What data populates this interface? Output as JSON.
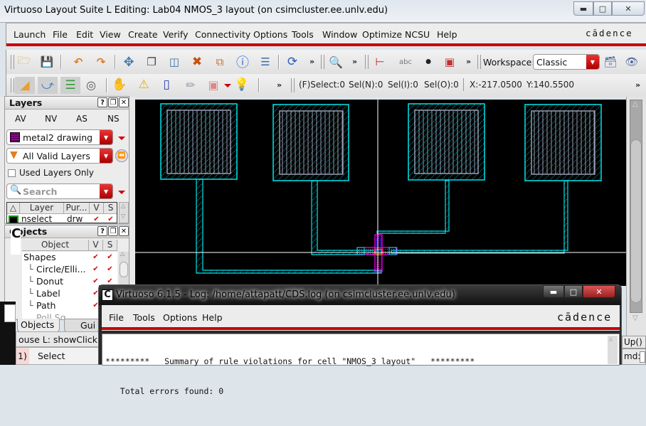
{
  "window": {
    "title": "Virtuoso Layout Suite L Editing: Lab04 NMOS_3 layout (on csimcluster.ee.unlv.edu)",
    "controls": {
      "minimize": "minimize-icon",
      "maximize": "maximize-icon",
      "close": "close-icon"
    }
  },
  "menubar": {
    "items": [
      "Launch",
      "File",
      "Edit",
      "View",
      "Create",
      "Verify",
      "Connectivity",
      "Options",
      "Tools",
      "Window",
      "Optimize",
      "NCSU",
      "Help"
    ],
    "brand": "cādence"
  },
  "toolbar1": {
    "icons": [
      "open-folder-icon",
      "save-icon",
      "undo-icon",
      "redo-icon",
      "move-icon",
      "copy-icon",
      "stretch-icon",
      "delete-icon",
      "properties-icon",
      "info-icon",
      "align-icon",
      "rotate-icon",
      "zoom-icon",
      "create-pin-icon",
      "label-icon",
      "instance-icon",
      "select-icon",
      "workspace-save-icon",
      "workspace-hide-icon"
    ],
    "more": "»",
    "workspace_label": "Workspace:",
    "workspace_value": "Classic"
  },
  "toolbar2": {
    "icons": [
      "select-mode-icon",
      "route-icon",
      "layer-stack-icon",
      "select-area-icon",
      "stop-marker-icon",
      "warning-marker-icon",
      "height-marker-icon",
      "ruler-icon",
      "via-icon",
      "lightbulb-icon"
    ],
    "more": "»",
    "status": {
      "fselect": "(F)Select:0",
      "seln": "Sel(N):0",
      "seli": "Sel(I):0",
      "selo": "Sel(O):0",
      "x": "X:-217.0500",
      "y": "Y:140.5500"
    }
  },
  "layers_panel": {
    "title": "Layers",
    "tabs": [
      "AV",
      "NV",
      "AS",
      "NS"
    ],
    "current_layer": "metal2 drawing",
    "filter": "All Valid Layers",
    "used_layers_only": {
      "label": "Used Layers Only",
      "checked": false
    },
    "search_placeholder": "Search",
    "columns": [
      "Layer",
      "Pur...",
      "V",
      "S"
    ],
    "rows": [
      {
        "layer": "nselect",
        "purpose": "drw",
        "v": true,
        "s": true
      }
    ]
  },
  "objects_panel": {
    "title": "Objects",
    "columns": [
      "Object",
      "V",
      "S"
    ],
    "items": [
      {
        "label": "Shapes",
        "v": true,
        "s": true,
        "level": 0
      },
      {
        "label": "Circle/Elli...",
        "v": true,
        "s": true,
        "level": 1
      },
      {
        "label": "Donut",
        "v": true,
        "s": true,
        "level": 1
      },
      {
        "label": "Label",
        "v": true,
        "s": true,
        "level": 1
      },
      {
        "label": "Path",
        "v": true,
        "s": true,
        "level": 1
      },
      {
        "label": "Poll Sg",
        "v": true,
        "s": true,
        "level": 1
      }
    ],
    "bottom_tabs": [
      "Objects",
      "Gui"
    ]
  },
  "bottom_status": {
    "mouse": "ouse L: showClickI",
    "mode_num": "1)",
    "mode": "Select",
    "right_fn": "Up()",
    "cmd_label": "md:"
  },
  "log_window": {
    "title": "Virtuoso 6.1.5 - Log: /home/attapatt/CDS.log (on csimcluster.ee.unlv.edu)",
    "menu": [
      "File",
      "Tools",
      "Options",
      "Help"
    ],
    "brand": "cādence",
    "lines": [
      "*********   Summary of rule violations for cell \"NMOS_3 layout\"   *********",
      "   Total errors found: 0"
    ]
  },
  "colors": {
    "brand_red": "#cc0000",
    "metal": "#00e5ee",
    "via": "#9a9ab0",
    "poly": "#ff00ff",
    "canvas": "#000000"
  }
}
